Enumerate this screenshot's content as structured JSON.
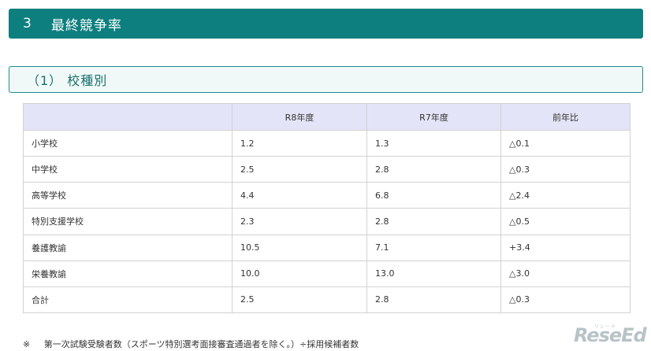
{
  "section": {
    "number": "3",
    "title": "最終競争率"
  },
  "subsection": {
    "title": "（1） 校種別"
  },
  "table": {
    "headers": [
      "",
      "R8年度",
      "R7年度",
      "前年比"
    ],
    "rows": [
      [
        "小学校",
        "1.2",
        "1.3",
        "△0.1"
      ],
      [
        "中学校",
        "2.5",
        "2.8",
        "△0.3"
      ],
      [
        "高等学校",
        "4.4",
        "6.8",
        "△2.4"
      ],
      [
        "特別支援学校",
        "2.3",
        "2.8",
        "△0.5"
      ],
      [
        "養護教諭",
        "10.5",
        "7.1",
        "+3.4"
      ],
      [
        "栄養教諭",
        "10.0",
        "13.0",
        "△3.0"
      ],
      [
        "合計",
        "2.5",
        "2.8",
        "△0.3"
      ]
    ]
  },
  "footnote": {
    "mark": "※",
    "text": "第一次試験受験者数（スポーツ特別選考面接審査通過者を除く。）÷採用候補者数"
  },
  "watermark": {
    "text": "ReseEd",
    "subtext": "リシード"
  }
}
